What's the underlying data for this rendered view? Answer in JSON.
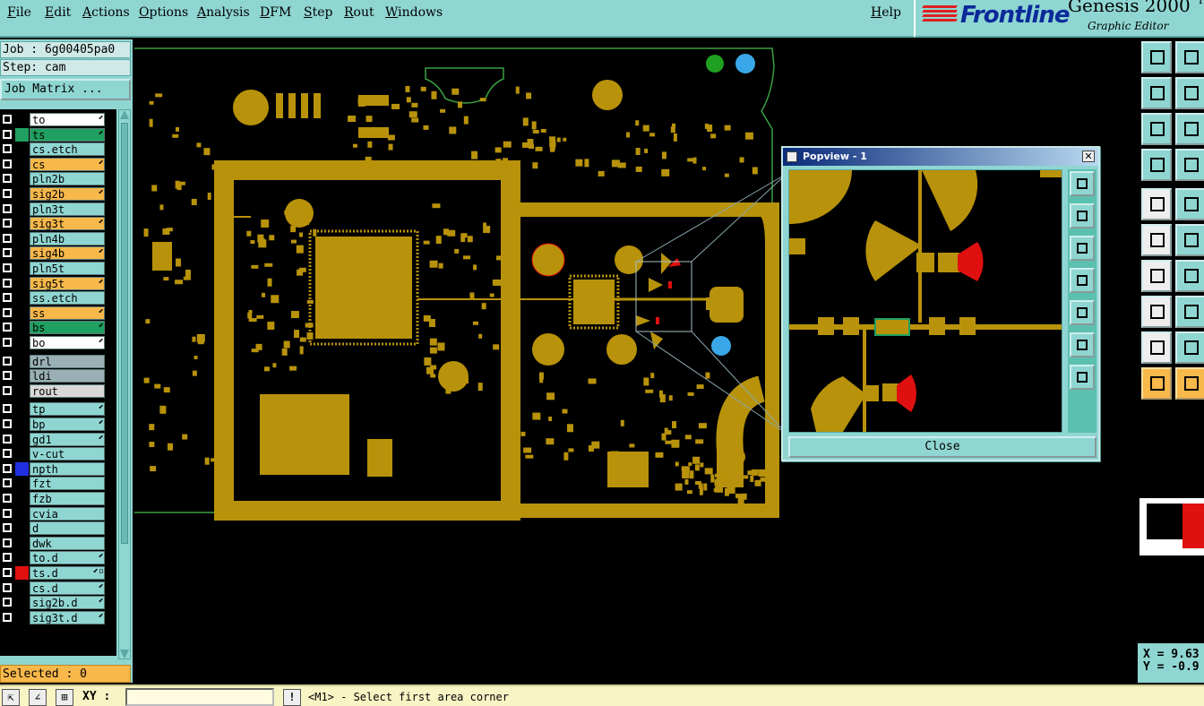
{
  "menu": {
    "items": [
      "File",
      "Edit",
      "Actions",
      "Options",
      "Analysis",
      "DFM",
      "Step",
      "Rout",
      "Windows"
    ],
    "help": "Help"
  },
  "brand": {
    "logo": "Frontline",
    "product": "Genesis 2000 ™",
    "subtitle": "Graphic Editor"
  },
  "job": {
    "job_line": "Job : 6g00405pa0",
    "step_line": "Step: cam",
    "matrix_button": "Job Matrix ..."
  },
  "layers": [
    {
      "name": "to",
      "color": "#ffffff",
      "swatch": "#000000",
      "tick": "⬋"
    },
    {
      "name": "ts",
      "color": "#20a060",
      "swatch": "#20a060",
      "tick": "⬋"
    },
    {
      "name": "cs.etch",
      "color": "#8fd6d2",
      "swatch": "#000000",
      "tick": ""
    },
    {
      "name": "cs",
      "color": "#f8b84a",
      "swatch": "#000000",
      "tick": "⬋"
    },
    {
      "name": "pln2b",
      "color": "#8fd6d2",
      "swatch": "#000000",
      "tick": ""
    },
    {
      "name": "sig2b",
      "color": "#f8b84a",
      "swatch": "#000000",
      "tick": "⬋"
    },
    {
      "name": "pln3t",
      "color": "#8fd6d2",
      "swatch": "#000000",
      "tick": ""
    },
    {
      "name": "sig3t",
      "color": "#f8b84a",
      "swatch": "#000000",
      "tick": "⬋"
    },
    {
      "name": "pln4b",
      "color": "#8fd6d2",
      "swatch": "#000000",
      "tick": ""
    },
    {
      "name": "sig4b",
      "color": "#f8b84a",
      "swatch": "#000000",
      "tick": "⬋"
    },
    {
      "name": "pln5t",
      "color": "#8fd6d2",
      "swatch": "#000000",
      "tick": ""
    },
    {
      "name": "sig5t",
      "color": "#f8b84a",
      "swatch": "#000000",
      "tick": "⬋"
    },
    {
      "name": "ss.etch",
      "color": "#8fd6d2",
      "swatch": "#000000",
      "tick": ""
    },
    {
      "name": "ss",
      "color": "#f8b84a",
      "swatch": "#000000",
      "tick": "⬋"
    },
    {
      "name": "bs",
      "color": "#20a060",
      "swatch": "#000000",
      "tick": "⬋"
    },
    {
      "name": "bo",
      "color": "#ffffff",
      "swatch": "#000000",
      "tick": "⬋"
    },
    {
      "name": "drl",
      "color": "#9ab0b4",
      "swatch": "#000000",
      "tick": ""
    },
    {
      "name": "ldi",
      "color": "#9ab0b4",
      "swatch": "#000000",
      "tick": ""
    },
    {
      "name": "rout",
      "color": "#d8d8d8",
      "swatch": "#000000",
      "tick": ""
    },
    {
      "name": "tp",
      "color": "#8fd6d2",
      "swatch": "#000000",
      "tick": "⬋"
    },
    {
      "name": "bp",
      "color": "#8fd6d2",
      "swatch": "#000000",
      "tick": "⬋"
    },
    {
      "name": "gd1",
      "color": "#8fd6d2",
      "swatch": "#000000",
      "tick": "⬋"
    },
    {
      "name": "v-cut",
      "color": "#8fd6d2",
      "swatch": "#000000",
      "tick": ""
    },
    {
      "name": "npth",
      "color": "#8fd6d2",
      "swatch": "#2030e0",
      "tick": ""
    },
    {
      "name": "fzt",
      "color": "#8fd6d2",
      "swatch": "#000000",
      "tick": ""
    },
    {
      "name": "fzb",
      "color": "#8fd6d2",
      "swatch": "#000000",
      "tick": ""
    },
    {
      "name": "cvia",
      "color": "#8fd6d2",
      "swatch": "#000000",
      "tick": ""
    },
    {
      "name": "d",
      "color": "#8fd6d2",
      "swatch": "#000000",
      "tick": ""
    },
    {
      "name": "dwk",
      "color": "#8fd6d2",
      "swatch": "#000000",
      "tick": ""
    },
    {
      "name": "to.d",
      "color": "#8fd6d2",
      "swatch": "#000000",
      "tick": "⬋"
    },
    {
      "name": "ts.d",
      "color": "#8fd6d2",
      "swatch": "#e01010",
      "tick": "⬋▫"
    },
    {
      "name": "cs.d",
      "color": "#8fd6d2",
      "swatch": "#000000",
      "tick": "⬋"
    },
    {
      "name": "sig2b.d",
      "color": "#8fd6d2",
      "swatch": "#000000",
      "tick": "⬋"
    },
    {
      "name": "sig3t.d",
      "color": "#8fd6d2",
      "swatch": "#000000",
      "tick": "⬋"
    }
  ],
  "selected": "Selected : 0",
  "status": {
    "xy_label": "XY :",
    "xy_value": "",
    "message": "<M1> - Select first area corner"
  },
  "coords": {
    "x": "X = 9.63",
    "y": "Y = -0.9"
  },
  "popview": {
    "title": "Popview - 1",
    "close_label": "Close",
    "close_x": "✕"
  },
  "colors": {
    "copper": "#b8920a",
    "outline": "#3aa040",
    "panel": "#8fd6d2",
    "highlight": "#f8b84a",
    "red": "#e01010",
    "blue": "#3aa8e8"
  }
}
